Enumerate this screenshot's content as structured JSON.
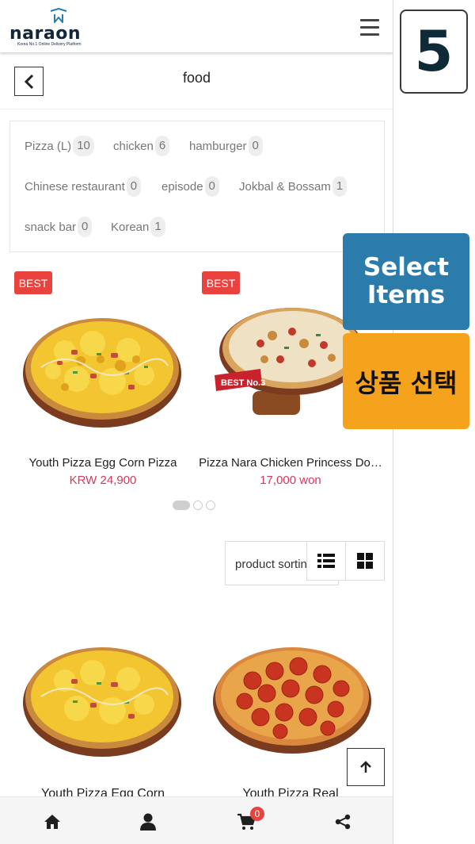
{
  "header": {
    "logo_text": "naraon",
    "logo_tagline": "Korea No.1 Online Delivery Platform",
    "menu_icon": "hamburger-icon"
  },
  "titlebar": {
    "back_icon": "chevron-left-icon",
    "title": "food"
  },
  "categories": [
    {
      "label": "Pizza (L)",
      "count": "10"
    },
    {
      "label": "chicken",
      "count": "6"
    },
    {
      "label": "hamburger",
      "count": "0"
    },
    {
      "label": "Chinese restaurant",
      "count": "0"
    },
    {
      "label": "episode",
      "count": "0"
    },
    {
      "label": "Jokbal & Bossam",
      "count": "1"
    },
    {
      "label": "snack bar",
      "count": "0"
    },
    {
      "label": "Korean",
      "count": "1"
    }
  ],
  "best_products": [
    {
      "badge": "BEST",
      "name": "Youth Pizza Egg Corn Pizza",
      "price": "KRW 24,900"
    },
    {
      "badge": "BEST",
      "name": "Pizza Nara Chicken Princess Do…",
      "price": "17,000 won",
      "image_stamp": "BEST No.3"
    }
  ],
  "carousel": {
    "pages": 3,
    "active_index": 0
  },
  "sort": {
    "label": "product sorting"
  },
  "view_icons": [
    "list-view-icon",
    "grid-view-icon"
  ],
  "grid_products": [
    {
      "name": "Youth Pizza Egg Corn"
    },
    {
      "name": "Youth Pizza Real"
    }
  ],
  "scroll_top_icon": "arrow-up-icon",
  "bottom_nav": {
    "items": [
      "home-icon",
      "user-icon",
      "cart-icon",
      "share-icon"
    ],
    "cart_count": "0"
  },
  "overlay": {
    "step_number": "5",
    "select_en_line1": "Select",
    "select_en_line2": "Items",
    "select_ko": "상품 선택"
  },
  "colors": {
    "best_badge": "#e8433f",
    "price": "#d23a5a",
    "tile_blue": "#2b7bab",
    "tile_orange": "#f5a31c",
    "logo_navy": "#14263b"
  }
}
